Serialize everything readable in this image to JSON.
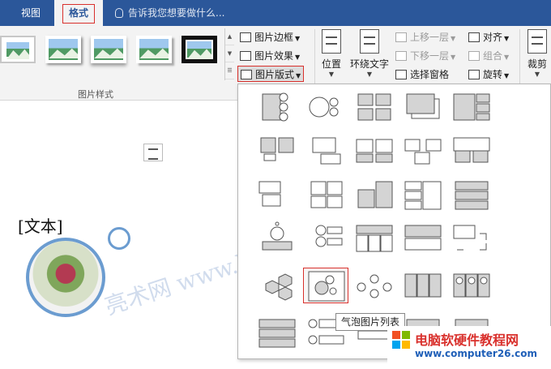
{
  "tabs": {
    "view": "视图",
    "format": "格式"
  },
  "tell_me": "告诉我您想要做什么...",
  "ribbon": {
    "picture_styles_label": "图片样式",
    "picture_border": "图片边框",
    "picture_effects": "图片效果",
    "picture_layout": "图片版式",
    "position": "位置",
    "wrap_text": "环绕文字",
    "bring_forward": "上移一层",
    "send_backward": "下移一层",
    "selection_pane": "选择窗格",
    "align": "对齐",
    "group": "组合",
    "rotate": "旋转",
    "crop": "裁剪"
  },
  "document": {
    "text_placeholder": "[文本]"
  },
  "dropdown": {
    "tooltip": "气泡图片列表",
    "selected_index": 21
  },
  "site": {
    "name": "电脑软硬件教程网",
    "url": "www.computer26.com"
  },
  "colors": {
    "accent": "#2b579a",
    "highlight": "#d9302c",
    "circle": "#6b9cd0"
  }
}
